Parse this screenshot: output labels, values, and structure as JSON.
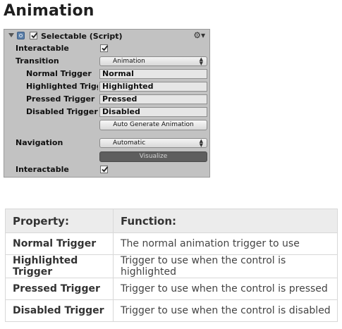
{
  "page": {
    "heading": "Animation"
  },
  "inspector": {
    "component_title": "Selectable (Script)",
    "enabled": true,
    "interactable_label": "Interactable",
    "interactable_checked": true,
    "transition_label": "Transition",
    "transition_value": "Animation",
    "triggers": [
      {
        "label": "Normal Trigger",
        "value": "Normal"
      },
      {
        "label": "Highlighted Trigg",
        "value": "Highlighted"
      },
      {
        "label": "Pressed Trigger",
        "value": "Pressed"
      },
      {
        "label": "Disabled Trigger",
        "value": "Disabled"
      }
    ],
    "auto_generate_label": "Auto Generate Animation",
    "navigation_label": "Navigation",
    "navigation_value": "Automatic",
    "visualize_label": "Visualize",
    "interactable_label_2": "Interactable",
    "interactable_checked_2": true,
    "icons": [
      "foldout-arrow-icon",
      "script-icon",
      "checkbox-icon",
      "gear-icon"
    ]
  },
  "table": {
    "headers": [
      "Property:",
      "Function:"
    ],
    "rows": [
      {
        "property": "Normal Trigger",
        "function": "The normal animation trigger to use"
      },
      {
        "property": "Highlighted Trigger",
        "function": "Trigger to use when the control is highlighted"
      },
      {
        "property": "Pressed Trigger",
        "function": "Trigger to use when the control is pressed"
      },
      {
        "property": "Disabled Trigger",
        "function": "Trigger to use when the control is disabled"
      }
    ]
  }
}
